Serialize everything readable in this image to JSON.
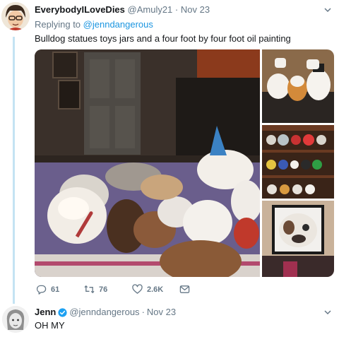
{
  "tweet": {
    "author_name": "EverybodyILoveDies",
    "author_handle": "@Amuly21",
    "separator": "·",
    "date": "Nov 23",
    "replying_prefix": "Replying to",
    "replying_to": "@jenndangerous",
    "text": "Bulldog statues toys jars and a four foot by four foot oil painting",
    "actions": {
      "replies": "61",
      "retweets": "76",
      "likes": "2.6K"
    }
  },
  "reply": {
    "author_name": "Jenn",
    "author_handle": "@jenndangerous",
    "separator": "·",
    "date": "Nov 23",
    "text": "OH MY"
  },
  "icons": {
    "reply": "reply-icon",
    "retweet": "retweet-icon",
    "like": "heart-icon",
    "dm": "envelope-icon",
    "verified": "verified-badge-icon",
    "more": "chevron-down-icon"
  },
  "colors": {
    "link": "#1b95e0",
    "secondary_text": "#657786",
    "thread_line": "#c4e3f3",
    "verified": "#1da1f2"
  }
}
